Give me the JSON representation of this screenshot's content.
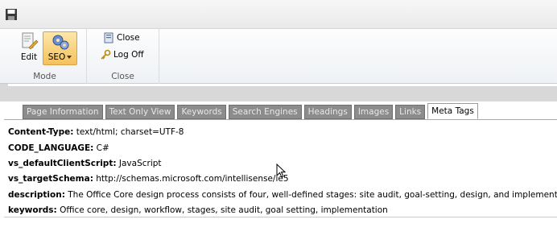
{
  "quick_access": {
    "save_icon": "floppy-disk-icon"
  },
  "ribbon": {
    "mode_group": {
      "label": "Mode",
      "edit_label": "Edit",
      "seo_label": "SEO"
    },
    "close_group": {
      "label": "Close",
      "close_label": "Close",
      "logoff_label": "Log Off"
    }
  },
  "tabs": [
    {
      "label": "Page Information",
      "active": false
    },
    {
      "label": "Text Only View",
      "active": false
    },
    {
      "label": "Keywords",
      "active": false
    },
    {
      "label": "Search Engines",
      "active": false
    },
    {
      "label": "Headings",
      "active": false
    },
    {
      "label": "Images",
      "active": false
    },
    {
      "label": "Links",
      "active": false
    },
    {
      "label": "Meta Tags",
      "active": true
    }
  ],
  "meta_tags": [
    {
      "key": "Content-Type:",
      "value": " text/html; charset=UTF-8"
    },
    {
      "key": "CODE_LANGUAGE:",
      "value": " C#"
    },
    {
      "key": "vs_defaultClientScript:",
      "value": " JavaScript"
    },
    {
      "key": "vs_targetSchema:",
      "value": " http://schemas.microsoft.com/intellisense/ie5"
    },
    {
      "key": "description:",
      "value": " The Office Core design process consists of four, well-defined stages: site audit, goal-setting, design, and implementation"
    },
    {
      "key": "keywords:",
      "value": " Office core, design, workflow, stages, site audit, goal setting, implementation"
    }
  ]
}
